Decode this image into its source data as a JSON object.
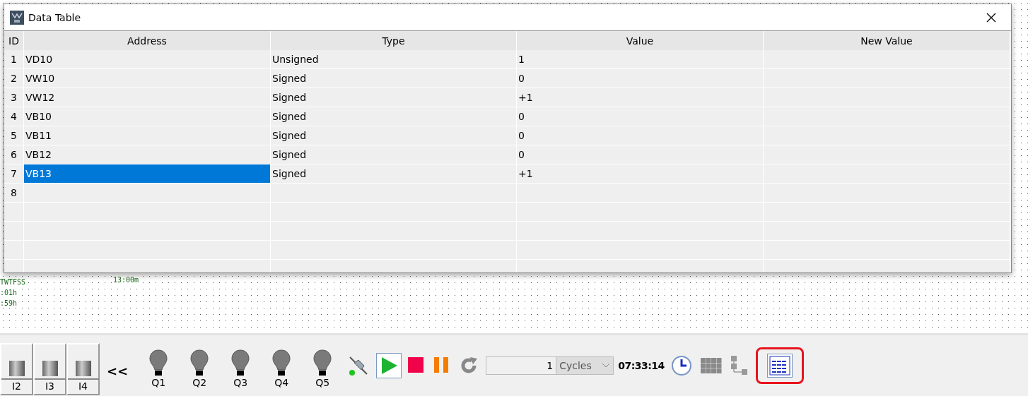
{
  "canvas_labels": [
    {
      "text": "TWTFSS"
    },
    {
      "text": "13:00m"
    },
    {
      "text": ":01h"
    },
    {
      "text": ":59h"
    }
  ],
  "window": {
    "title": "Data Table",
    "columns": [
      "ID",
      "Address",
      "Type",
      "Value",
      "New Value"
    ],
    "rows": [
      {
        "id": "1",
        "address": "VD10",
        "type": "Unsigned",
        "value": "1",
        "selected": false
      },
      {
        "id": "2",
        "address": "VW10",
        "type": "Signed",
        "value": "0",
        "selected": false
      },
      {
        "id": "3",
        "address": "VW12",
        "type": "Signed",
        "value": "+1",
        "selected": false
      },
      {
        "id": "4",
        "address": "VB10",
        "type": "Signed",
        "value": "0",
        "selected": false
      },
      {
        "id": "5",
        "address": "VB11",
        "type": "Signed",
        "value": "0",
        "selected": false
      },
      {
        "id": "6",
        "address": "VB12",
        "type": "Signed",
        "value": "0",
        "selected": false
      },
      {
        "id": "7",
        "address": "VB13",
        "type": "Signed",
        "value": "+1",
        "selected": true
      },
      {
        "id": "8",
        "selected": false
      }
    ]
  },
  "toolbar": {
    "inputs": [
      {
        "label": "I2"
      },
      {
        "label": "I3"
      },
      {
        "label": "I4"
      }
    ],
    "collapse": "<<",
    "outputs": [
      {
        "label": "Q1",
        "on": false
      },
      {
        "label": "Q2",
        "on": false
      },
      {
        "label": "Q3",
        "on": false
      },
      {
        "label": "Q4",
        "on": false
      },
      {
        "label": "Q5",
        "on": false
      }
    ],
    "cycles": {
      "value": "1",
      "unit": "Cycles"
    },
    "time": "07:33:14",
    "data_table_button": {
      "selected": true
    }
  }
}
